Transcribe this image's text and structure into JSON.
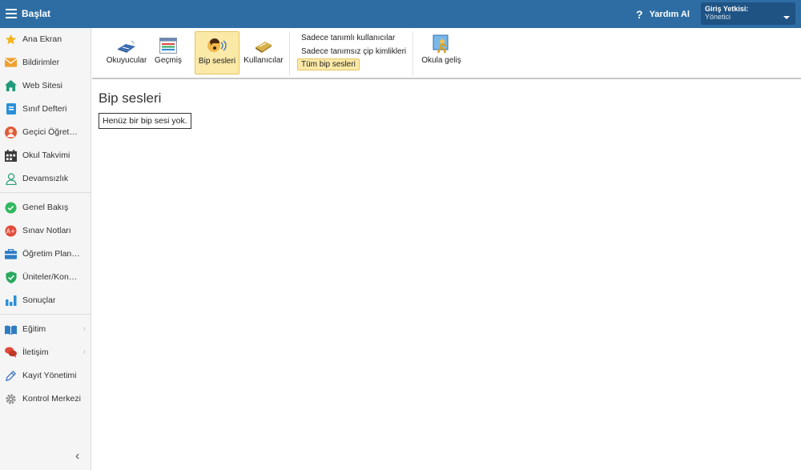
{
  "header": {
    "title": "Başlat",
    "help_label": "Yardım Al",
    "role_label": "Giriş Yetkisi:",
    "role_value": "Yönetici"
  },
  "sidebar": {
    "items": [
      {
        "label": "Ana Ekran",
        "icon": "star-icon"
      },
      {
        "label": "Bildirimler",
        "icon": "envelope-icon"
      },
      {
        "label": "Web Sitesi",
        "icon": "house-icon"
      },
      {
        "label": "Sınıf Defteri",
        "icon": "notebook-icon"
      },
      {
        "label": "Geçici Öğretmen",
        "icon": "teacher-icon"
      },
      {
        "label": "Okul Takvimi",
        "icon": "calendar-icon"
      },
      {
        "label": "Devamsızlık",
        "icon": "person-icon"
      },
      {
        "label": "Genel Bakış",
        "icon": "check-circle-icon"
      },
      {
        "label": "Sınav Notları",
        "icon": "grade-icon"
      },
      {
        "label": "Öğretim Planları",
        "icon": "briefcase-icon"
      },
      {
        "label": "Üniteler/Konular",
        "icon": "shield-check-icon"
      },
      {
        "label": "Sonuçlar",
        "icon": "bar-chart-icon"
      },
      {
        "label": "Eğitim",
        "icon": "book-icon"
      },
      {
        "label": "İletişim",
        "icon": "chat-icon"
      },
      {
        "label": "Kayıt Yönetimi",
        "icon": "pen-icon"
      },
      {
        "label": "Kontrol Merkezi",
        "icon": "gear-icon"
      }
    ]
  },
  "toolbar": {
    "buttons": [
      {
        "label": "Okuyucular",
        "icon": "reader-icon"
      },
      {
        "label": "Geçmiş",
        "icon": "history-icon"
      },
      {
        "label": "Bip sesleri",
        "icon": "beep-icon"
      },
      {
        "label": "Kullanıcılar",
        "icon": "users-card-icon"
      },
      {
        "label": "Okula geliş",
        "icon": "arrival-icon"
      }
    ],
    "filters": [
      {
        "label": "Sadece tanımlı kullanıcılar"
      },
      {
        "label": "Sadece tanımsız çip kimlikleri"
      },
      {
        "label": "Tüm bip sesleri"
      }
    ],
    "active_button": "Bip sesleri",
    "active_filter": "Tüm bip sesleri"
  },
  "main": {
    "title": "Bip sesleri",
    "empty_message": "Henüz bir bip sesi yok."
  },
  "colors": {
    "header_bg": "#2d6da3",
    "active_bg": "#fbe9a8"
  }
}
